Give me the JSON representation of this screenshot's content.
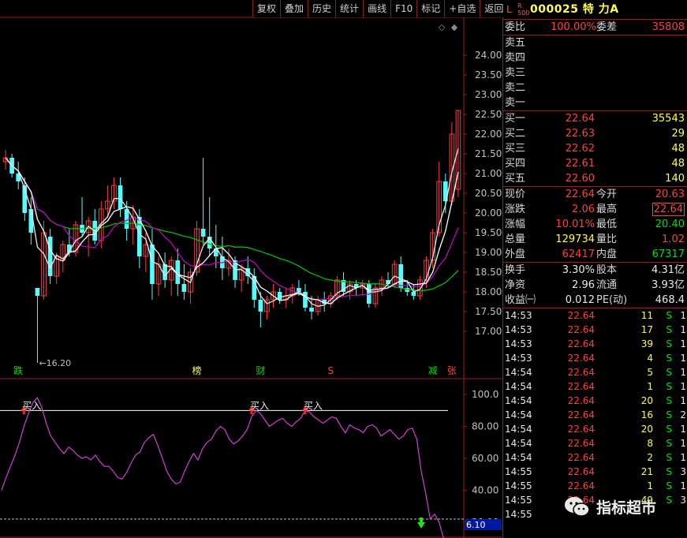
{
  "toolbar": [
    "复权",
    "叠加",
    "历史",
    "统计",
    "画线",
    "F10",
    "标记",
    "+自选",
    "返回"
  ],
  "header": {
    "L": "L",
    "R": "R",
    "R_sub": "500",
    "code_name": "000025 特 力A"
  },
  "weibi": {
    "label1": "委比",
    "val1": "100.00%",
    "label2": "委差",
    "val2": "35808"
  },
  "asks": [
    {
      "label": "卖五"
    },
    {
      "label": "卖四"
    },
    {
      "label": "卖三"
    },
    {
      "label": "卖二"
    },
    {
      "label": "卖一"
    }
  ],
  "bids": [
    {
      "label": "买一",
      "price": "22.64",
      "vol": "35543"
    },
    {
      "label": "买二",
      "price": "22.63",
      "vol": "29"
    },
    {
      "label": "买三",
      "price": "22.62",
      "vol": "48"
    },
    {
      "label": "买四",
      "price": "22.61",
      "vol": "48"
    },
    {
      "label": "买五",
      "price": "22.60",
      "vol": "140"
    }
  ],
  "quote": [
    {
      "l1": "现价",
      "v1": "22.64",
      "c1": "#ff4040",
      "l2": "今开",
      "v2": "20.63",
      "c2": "#ff4040"
    },
    {
      "l1": "涨跌",
      "v1": "2.06",
      "c1": "#ff4040",
      "l2": "最高",
      "v2": "22.64",
      "c2": "#ff4040"
    },
    {
      "l1": "涨幅",
      "v1": "10.01%",
      "c1": "#ff4040",
      "l2": "最低",
      "v2": "20.40",
      "c2": "#00e000"
    },
    {
      "l1": "总量",
      "v1": "129734",
      "c1": "#ffff40",
      "l2": "量比",
      "v2": "1.02",
      "c2": "#ff4040"
    },
    {
      "l1": "外盘",
      "v1": "62417",
      "c1": "#ff4040",
      "l2": "内盘",
      "v2": "67317",
      "c2": "#00e000"
    }
  ],
  "stats": [
    {
      "l1": "换手",
      "v1": "3.30%",
      "l2": "股本",
      "v2": "4.31亿"
    },
    {
      "l1": "净资",
      "v1": "2.96",
      "l2": "流通",
      "v2": "3.93亿"
    },
    {
      "l1": "收益㈠",
      "v1": "0.012",
      "l2": "PE(动)",
      "v2": "468.4"
    }
  ],
  "ticks": [
    {
      "time": "14:53",
      "price": "22.64",
      "vol": "11",
      "bs": "S",
      "n": "1"
    },
    {
      "time": "14:53",
      "price": "22.64",
      "vol": "17",
      "bs": "S",
      "n": "1"
    },
    {
      "time": "14:53",
      "price": "22.64",
      "vol": "39",
      "bs": "S",
      "n": "1"
    },
    {
      "time": "14:53",
      "price": "22.64",
      "vol": "4",
      "bs": "S",
      "n": "1"
    },
    {
      "time": "14:54",
      "price": "22.64",
      "vol": "5",
      "bs": "S",
      "n": "1"
    },
    {
      "time": "14:54",
      "price": "22.64",
      "vol": "1",
      "bs": "S",
      "n": "1"
    },
    {
      "time": "14:54",
      "price": "22.64",
      "vol": "20",
      "bs": "S",
      "n": "1"
    },
    {
      "time": "14:54",
      "price": "22.64",
      "vol": "16",
      "bs": "S",
      "n": "2"
    },
    {
      "time": "14:54",
      "price": "22.64",
      "vol": "20",
      "bs": "S",
      "n": "1"
    },
    {
      "time": "14:54",
      "price": "22.64",
      "vol": "8",
      "bs": "S",
      "n": "1"
    },
    {
      "time": "14:54",
      "price": "22.64",
      "vol": "2",
      "bs": "S",
      "n": "1"
    },
    {
      "time": "14:55",
      "price": "22.64",
      "vol": "21",
      "bs": "S",
      "n": "3"
    },
    {
      "time": "14:55",
      "price": "22.64",
      "vol": "1",
      "bs": "S",
      "n": "1"
    },
    {
      "time": "14:55",
      "price": "22.64",
      "vol": "49",
      "bs": "S",
      "n": "3"
    },
    {
      "time": "14:55",
      "price": "",
      "vol": "",
      "bs": "",
      "n": ""
    }
  ],
  "watermark": "指标超市",
  "chart_data": [
    {
      "type": "candlestick",
      "ylim": [
        16.5,
        24.5
      ],
      "y_ticks": [
        17.0,
        17.5,
        18.0,
        18.5,
        19.0,
        19.5,
        20.0,
        20.5,
        21.0,
        21.5,
        22.0,
        22.5,
        23.0,
        23.5,
        24.0
      ],
      "y_tick_labels": [
        "17.00",
        "17.50",
        "18.00",
        "18.50",
        "19.00",
        "19.50",
        "20.00",
        "20.50",
        "21.00",
        "21.50",
        "22.00",
        "22.50",
        "23.00",
        "23.50",
        "24.00"
      ],
      "low_label": "←16.20",
      "event_markers": [
        {
          "text": "跌",
          "index": 2,
          "color": "#00e000"
        },
        {
          "text": "榜",
          "index": 30,
          "color": "#ffff40"
        },
        {
          "text": "财",
          "index": 40,
          "color": "#00e000"
        },
        {
          "text": "S",
          "index": 51,
          "color": "#ff4040"
        },
        {
          "text": "减",
          "index": 67,
          "color": "#00e000"
        },
        {
          "text": "张",
          "index": 70,
          "color": "#ff4040"
        }
      ],
      "ohlc": [
        [
          21.3,
          21.6,
          21.1,
          21.4
        ],
        [
          21.4,
          21.5,
          20.9,
          21.0
        ],
        [
          21.0,
          21.3,
          20.6,
          20.8
        ],
        [
          20.7,
          20.9,
          19.8,
          20.0
        ],
        [
          20.1,
          20.4,
          19.2,
          19.5
        ],
        [
          18.1,
          18.1,
          16.2,
          17.9
        ],
        [
          17.9,
          19.8,
          17.8,
          19.5
        ],
        [
          19.4,
          19.6,
          18.2,
          18.4
        ],
        [
          18.4,
          19.0,
          18.2,
          18.9
        ],
        [
          18.8,
          19.3,
          18.5,
          19.2
        ],
        [
          19.2,
          19.6,
          18.9,
          19.0
        ],
        [
          19.0,
          19.8,
          18.9,
          19.7
        ],
        [
          19.7,
          20.4,
          19.4,
          19.5
        ],
        [
          19.5,
          19.9,
          18.9,
          19.8
        ],
        [
          19.8,
          20.1,
          19.2,
          19.3
        ],
        [
          19.3,
          20.3,
          19.1,
          20.1
        ],
        [
          20.1,
          20.7,
          19.9,
          20.3
        ],
        [
          20.3,
          20.9,
          20.1,
          20.7
        ],
        [
          20.7,
          20.9,
          19.9,
          20.1
        ],
        [
          20.1,
          20.3,
          19.3,
          19.6
        ],
        [
          19.6,
          20.2,
          19.2,
          19.9
        ],
        [
          19.9,
          20.1,
          18.6,
          18.9
        ],
        [
          18.9,
          19.5,
          18.5,
          19.2
        ],
        [
          19.2,
          19.6,
          17.8,
          18.2
        ],
        [
          18.2,
          18.9,
          17.9,
          18.7
        ],
        [
          18.7,
          19.0,
          18.1,
          18.3
        ],
        [
          18.3,
          18.9,
          17.9,
          18.8
        ],
        [
          18.8,
          19.1,
          17.9,
          18.2
        ],
        [
          18.2,
          18.7,
          17.8,
          18.0
        ],
        [
          18.0,
          18.6,
          17.7,
          18.5
        ],
        [
          18.5,
          19.8,
          18.4,
          19.6
        ],
        [
          19.6,
          21.4,
          19.2,
          19.4
        ],
        [
          19.4,
          20.4,
          18.9,
          19.1
        ],
        [
          19.1,
          19.7,
          18.6,
          18.9
        ],
        [
          18.9,
          19.4,
          18.3,
          18.6
        ],
        [
          18.6,
          19.1,
          18.4,
          18.8
        ],
        [
          18.8,
          18.9,
          18.1,
          18.3
        ],
        [
          18.3,
          18.7,
          18.0,
          18.6
        ],
        [
          18.6,
          18.9,
          18.2,
          18.4
        ],
        [
          18.4,
          18.6,
          17.6,
          17.8
        ],
        [
          17.8,
          18.0,
          17.1,
          17.5
        ],
        [
          17.5,
          17.9,
          17.3,
          17.8
        ],
        [
          17.8,
          18.2,
          17.6,
          18.0
        ],
        [
          18.0,
          18.1,
          17.7,
          17.8
        ],
        [
          17.8,
          18.1,
          17.6,
          17.9
        ],
        [
          17.9,
          18.2,
          17.7,
          18.1
        ],
        [
          18.1,
          18.3,
          17.9,
          18.0
        ],
        [
          18.0,
          18.2,
          17.5,
          17.6
        ],
        [
          17.6,
          17.9,
          17.3,
          17.5
        ],
        [
          17.5,
          17.9,
          17.4,
          17.8
        ],
        [
          17.8,
          18.0,
          17.5,
          17.7
        ],
        [
          17.7,
          18.0,
          17.6,
          17.9
        ],
        [
          17.9,
          18.4,
          17.8,
          18.3
        ],
        [
          18.3,
          18.5,
          17.9,
          18.0
        ],
        [
          18.0,
          18.3,
          17.8,
          18.2
        ],
        [
          18.2,
          18.3,
          17.9,
          18.1
        ],
        [
          18.1,
          18.3,
          17.9,
          18.2
        ],
        [
          18.2,
          18.3,
          17.6,
          17.7
        ],
        [
          17.7,
          18.2,
          17.6,
          18.1
        ],
        [
          18.1,
          18.4,
          17.9,
          18.3
        ],
        [
          18.3,
          18.5,
          18.1,
          18.2
        ],
        [
          18.2,
          18.8,
          18.1,
          18.7
        ],
        [
          18.7,
          18.9,
          18.0,
          18.1
        ],
        [
          18.1,
          18.3,
          17.9,
          18.0
        ],
        [
          18.0,
          18.2,
          17.8,
          17.9
        ],
        [
          17.9,
          18.4,
          17.8,
          18.3
        ],
        [
          18.3,
          18.9,
          18.1,
          18.8
        ],
        [
          18.8,
          19.6,
          18.6,
          19.5
        ],
        [
          19.5,
          21.3,
          19.4,
          20.8
        ],
        [
          20.8,
          21.0,
          20.0,
          20.3
        ],
        [
          20.3,
          22.3,
          20.2,
          22.0
        ],
        [
          20.6,
          22.6,
          20.4,
          22.6
        ]
      ]
    },
    {
      "type": "line",
      "ylim": [
        15,
        105
      ],
      "y_ticks": [
        20.0,
        40.0,
        60.0,
        80.0,
        100.0
      ],
      "y_tick_labels": [
        "20.00",
        "40.00",
        "60.00",
        "80.00",
        "100.0"
      ],
      "ref_line": 90,
      "current_label": "6.10",
      "signals": [
        {
          "text": "买入",
          "index": 5
        },
        {
          "text": "买入",
          "index": 56
        },
        {
          "text": "买入",
          "index": 68
        }
      ],
      "sell_signal_index": 94,
      "values": [
        40,
        48,
        55,
        62,
        70,
        80,
        88,
        95,
        98,
        92,
        82,
        74,
        70,
        66,
        63,
        67,
        65,
        62,
        60,
        61,
        59,
        62,
        58,
        55,
        55,
        52,
        48,
        47,
        51,
        57,
        62,
        64,
        70,
        73,
        75,
        68,
        60,
        52,
        47,
        44,
        45,
        52,
        58,
        63,
        59,
        66,
        70,
        72,
        77,
        80,
        78,
        72,
        69,
        71,
        74,
        78,
        86,
        90,
        88,
        84,
        80,
        82,
        84,
        85,
        82,
        80,
        83,
        85,
        90,
        89,
        86,
        84,
        82,
        84,
        86,
        85,
        80,
        76,
        81,
        79,
        78,
        76,
        80,
        81,
        79,
        74,
        76,
        78,
        75,
        72,
        74,
        78,
        79,
        72,
        52,
        38,
        22,
        25,
        20,
        10,
        6.1
      ]
    }
  ]
}
